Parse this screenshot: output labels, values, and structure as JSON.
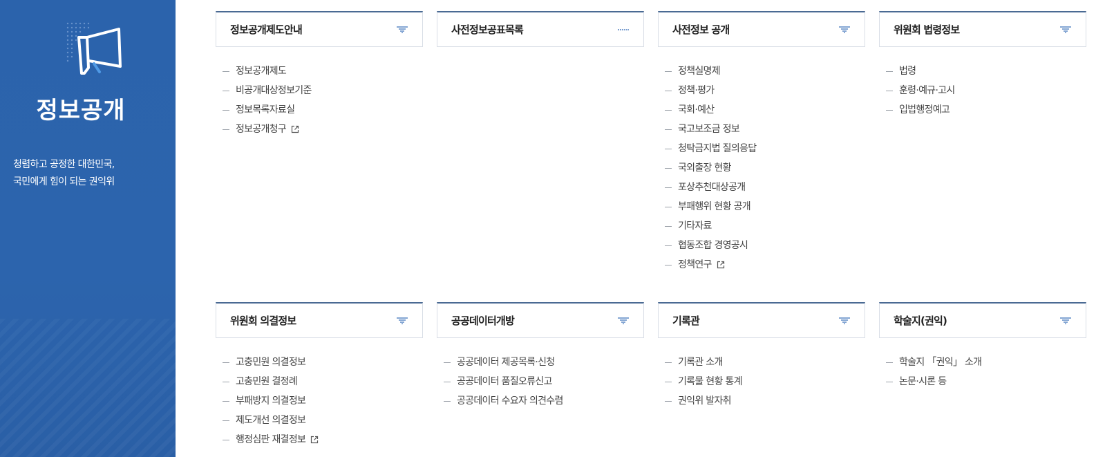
{
  "sidebar": {
    "logo_icon": "megaphone-icon",
    "title": "정보공개",
    "slogan_line1": "청렴하고 공정한 대한민국,",
    "slogan_line2": "국민에게 힘이 되는 권익위",
    "bg_color": "#2b63ac"
  },
  "cards": [
    {
      "title": "정보공개제도안내",
      "toggle": "filter",
      "items": [
        {
          "label": "정보공개제도",
          "external": false
        },
        {
          "label": "비공개대상정보기준",
          "external": false
        },
        {
          "label": "정보목록자료실",
          "external": false
        },
        {
          "label": "정보공개청구",
          "external": true
        }
      ]
    },
    {
      "title": "사전정보공표목록",
      "toggle": "dash",
      "items": []
    },
    {
      "title": "사전정보 공개",
      "toggle": "filter",
      "items": [
        {
          "label": "정책실명제",
          "external": false
        },
        {
          "label": "정책·평가",
          "external": false
        },
        {
          "label": "국회·예산",
          "external": false
        },
        {
          "label": "국고보조금 정보",
          "external": false
        },
        {
          "label": "청탁금지법 질의응답",
          "external": false
        },
        {
          "label": "국외출장 현황",
          "external": false
        },
        {
          "label": "포상추천대상공개",
          "external": false
        },
        {
          "label": "부패행위 현황 공개",
          "external": false
        },
        {
          "label": "기타자료",
          "external": false
        },
        {
          "label": "협동조합 경영공시",
          "external": false
        },
        {
          "label": "정책연구",
          "external": true
        }
      ]
    },
    {
      "title": "위원회 법령정보",
      "toggle": "filter",
      "items": [
        {
          "label": "법령",
          "external": false
        },
        {
          "label": "훈령·예규·고시",
          "external": false
        },
        {
          "label": "입법행정예고",
          "external": false
        }
      ]
    },
    {
      "title": "위원회 의결정보",
      "toggle": "filter",
      "items": [
        {
          "label": "고충민원 의결정보",
          "external": false
        },
        {
          "label": "고충민원 결정례",
          "external": false
        },
        {
          "label": "부패방지 의결정보",
          "external": false
        },
        {
          "label": "제도개선 의결정보",
          "external": false
        },
        {
          "label": "행정심판 재결정보",
          "external": true
        }
      ]
    },
    {
      "title": "공공데이터개방",
      "toggle": "filter",
      "items": [
        {
          "label": "공공데이터 제공목록·신청",
          "external": false
        },
        {
          "label": "공공데이터 품질오류신고",
          "external": false
        },
        {
          "label": "공공데이터 수요자 의견수렴",
          "external": false
        }
      ]
    },
    {
      "title": "기록관",
      "toggle": "filter",
      "items": [
        {
          "label": "기록관 소개",
          "external": false
        },
        {
          "label": "기록물 현황 통계",
          "external": false
        },
        {
          "label": "권익위 발자취",
          "external": false
        }
      ]
    },
    {
      "title": "학술지(권익)",
      "toggle": "filter",
      "items": [
        {
          "label": "학술지 「권익」 소개",
          "external": false
        },
        {
          "label": "논문·시론 등",
          "external": false
        }
      ]
    }
  ],
  "colors": {
    "accent": "#4a6a93",
    "icon": "#4f7fc0"
  }
}
